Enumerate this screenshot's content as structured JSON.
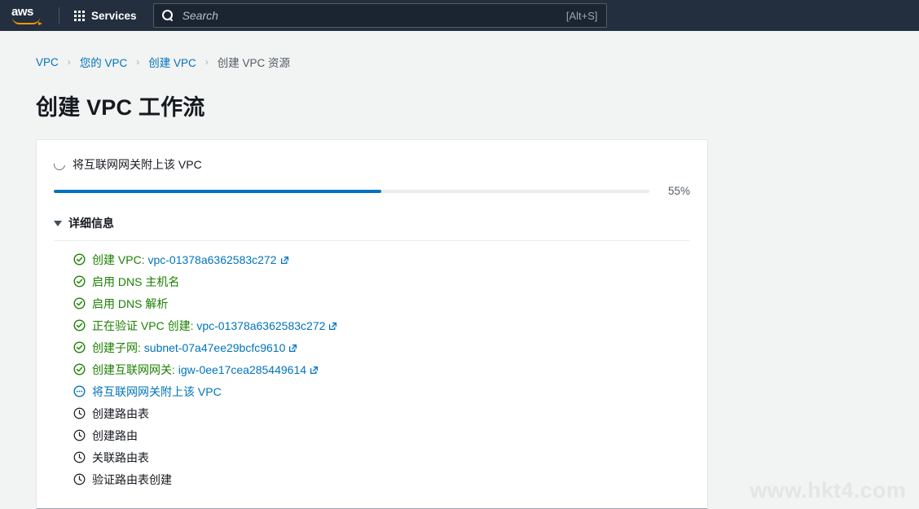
{
  "topnav": {
    "logo_text": "aws",
    "services_label": "Services",
    "search": {
      "placeholder": "Search",
      "shortcut": "[Alt+S]"
    }
  },
  "breadcrumb": {
    "separator": "›",
    "items": [
      {
        "label": "VPC",
        "current": false
      },
      {
        "label": "您的 VPC",
        "current": false
      },
      {
        "label": "创建 VPC",
        "current": false
      },
      {
        "label": "创建 VPC 资源",
        "current": true
      }
    ]
  },
  "page": {
    "title": "创建 VPC 工作流"
  },
  "workflow": {
    "current_status": "将互联网网关附上该 VPC",
    "progress_percent": 55,
    "progress_label": "55%",
    "details_label": "详细信息",
    "steps": [
      {
        "state": "done",
        "label": "创建 VPC:",
        "link": "vpc-01378a6362583c272",
        "external": true
      },
      {
        "state": "done",
        "label": "启用 DNS 主机名",
        "link": "",
        "external": false
      },
      {
        "state": "done",
        "label": "启用 DNS 解析",
        "link": "",
        "external": false
      },
      {
        "state": "done",
        "label": "正在验证 VPC 创建:",
        "link": "vpc-01378a6362583c272",
        "external": true
      },
      {
        "state": "done",
        "label": "创建子网:",
        "link": "subnet-07a47ee29bcfc9610",
        "external": true
      },
      {
        "state": "done",
        "label": "创建互联网网关:",
        "link": "igw-0ee17cea285449614",
        "external": true
      },
      {
        "state": "progress",
        "label": "将互联网网关附上该 VPC",
        "link": "",
        "external": false
      },
      {
        "state": "pending",
        "label": "创建路由表",
        "link": "",
        "external": false
      },
      {
        "state": "pending",
        "label": "创建路由",
        "link": "",
        "external": false
      },
      {
        "state": "pending",
        "label": "关联路由表",
        "link": "",
        "external": false
      },
      {
        "state": "pending",
        "label": "验证路由表创建",
        "link": "",
        "external": false
      }
    ]
  },
  "watermark": "www.hkt4.com",
  "colors": {
    "nav_background": "#232f3e",
    "accent_link": "#0073bb",
    "success_green": "#1d8102",
    "logo_orange": "#ff9900",
    "page_background": "#f2f3f3"
  }
}
